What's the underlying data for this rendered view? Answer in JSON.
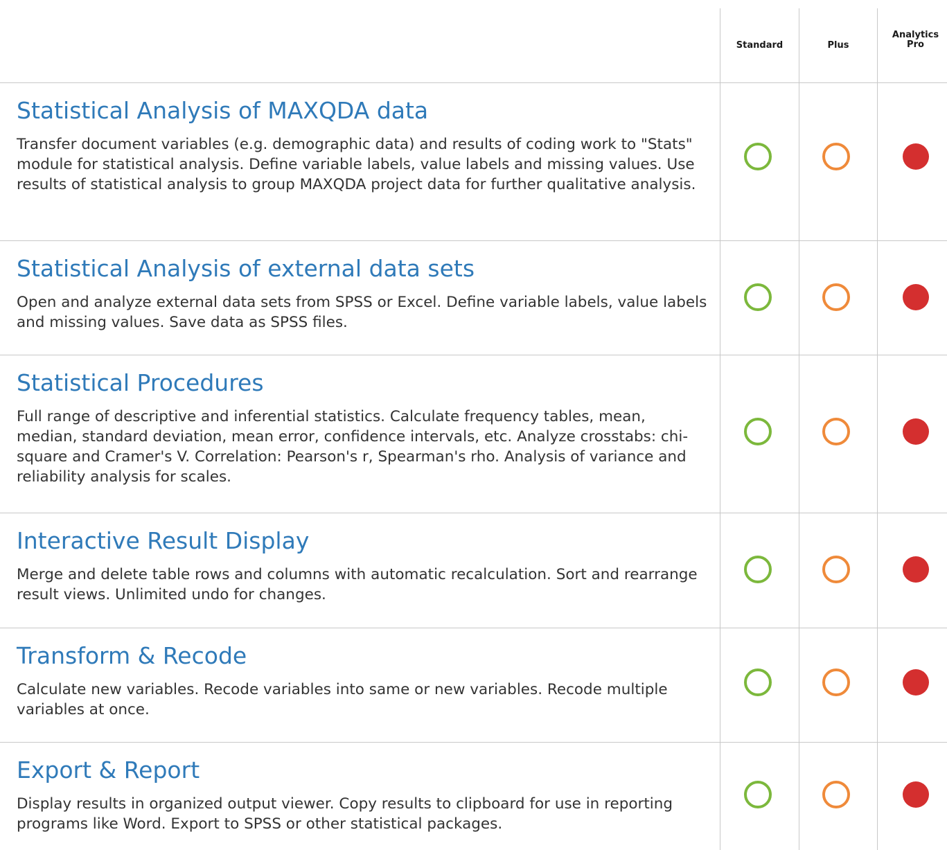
{
  "columns": {
    "standard": "Standard",
    "plus": "Plus",
    "pro_line1": "Analytics",
    "pro_line2": "Pro"
  },
  "colors": {
    "standard": "#7cb83c",
    "plus": "#ef8a3a",
    "pro": "#d42f2f",
    "title": "#2f7ab9"
  },
  "icons": {
    "standard": "open-circle-green-icon",
    "plus": "open-circle-orange-icon",
    "pro": "filled-circle-red-icon"
  },
  "features": [
    {
      "title": "Statistical Analysis of MAXQDA data",
      "description": "Transfer document variables (e.g. demographic data) and results of coding work to \"Stats\" module for statistical analysis. Define variable labels, value labels and missing values. Use results of statistical analysis to group MAXQDA project data for further qualitative analysis."
    },
    {
      "title": "Statistical Analysis of external data sets",
      "description": "Open and analyze external data sets from SPSS or Excel. Define variable labels, value labels and missing values. Save data as SPSS files."
    },
    {
      "title": "Statistical Procedures",
      "description": "Full range of descriptive and inferential statistics. Calculate frequency tables, mean, median, standard deviation, mean error, confidence intervals, etc. Analyze crosstabs: chi-square and Cramer's V. Correlation: Pearson's r, Spearman's rho. Analysis of variance and reliability analysis for scales."
    },
    {
      "title": "Interactive Result Display",
      "description": "Merge and delete table rows and columns with automatic recalculation. Sort and rearrange result views. Unlimited undo for changes."
    },
    {
      "title": "Transform & Recode",
      "description": "Calculate new variables. Recode variables into same or new variables. Recode multiple variables at once."
    },
    {
      "title": "Export & Report",
      "description": "Display results in organized output viewer. Copy results to clipboard for use in reporting programs like Word. Export to SPSS or other statistical packages."
    }
  ]
}
